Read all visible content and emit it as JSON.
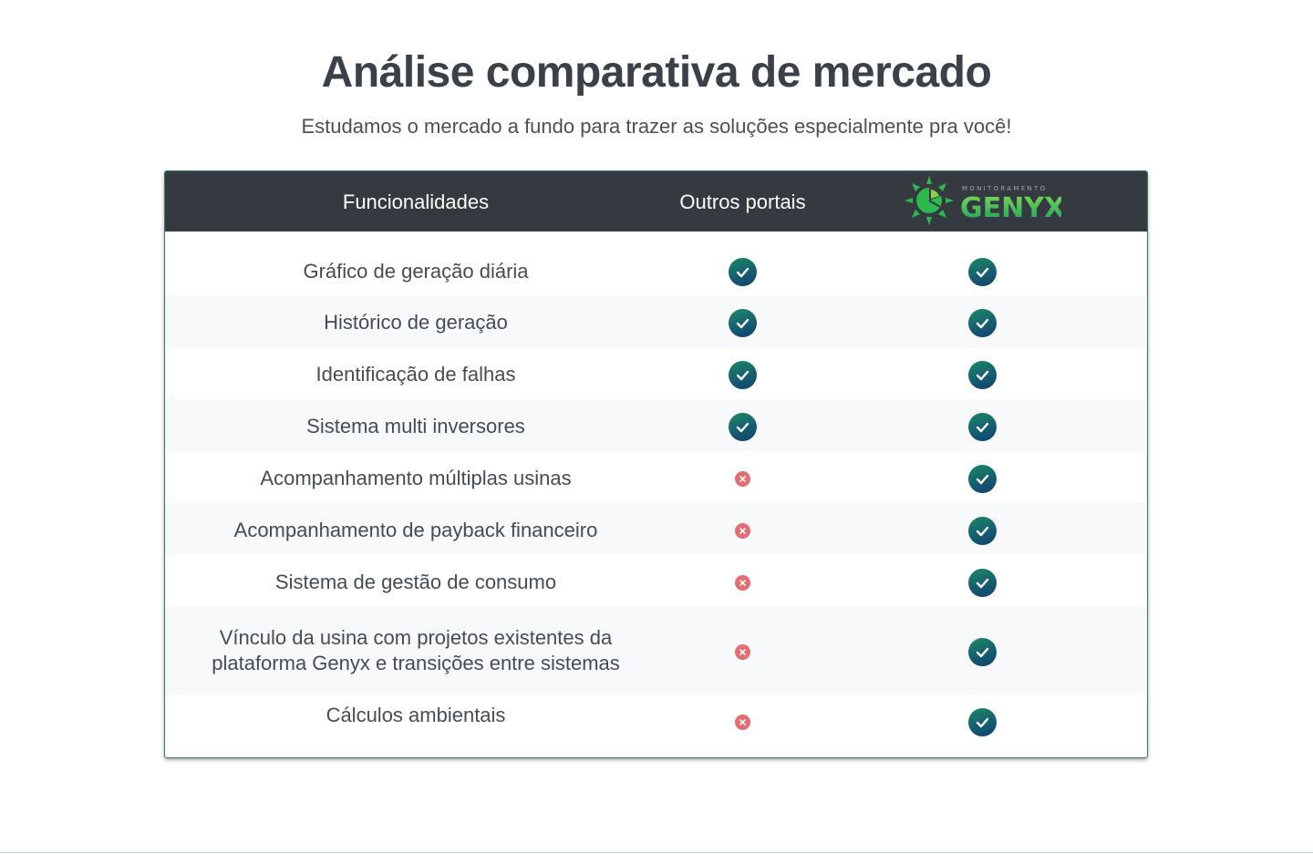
{
  "heading": {
    "title": "Análise comparativa de mercado",
    "subtitle": "Estudamos o mercado a fundo para trazer as soluções especialmente pra você!"
  },
  "table": {
    "columns": {
      "features": "Funcionalidades",
      "others": "Outros portais",
      "genyx_logo": {
        "tagline": "MONITORAMENTO",
        "brand": "GENYX"
      }
    },
    "rows": [
      {
        "feature": "Gráfico de geração diária",
        "others": "check",
        "genyx": "check"
      },
      {
        "feature": "Histórico de geração",
        "others": "check",
        "genyx": "check"
      },
      {
        "feature": "Identificação de falhas",
        "others": "check",
        "genyx": "check"
      },
      {
        "feature": "Sistema multi inversores",
        "others": "check",
        "genyx": "check"
      },
      {
        "feature": "Acompanhamento múltiplas usinas",
        "others": "cross",
        "genyx": "check"
      },
      {
        "feature": "Acompanhamento de payback financeiro",
        "others": "cross",
        "genyx": "check"
      },
      {
        "feature": "Sistema de gestão de consumo",
        "others": "cross",
        "genyx": "check"
      },
      {
        "feature_lines": [
          "Vínculo da usina com projetos existentes da",
          "plataforma Genyx e transições entre sistemas"
        ],
        "others": "cross",
        "genyx": "check"
      },
      {
        "feature": "Cálculos ambientais",
        "others": "cross",
        "genyx": "check"
      }
    ]
  },
  "colors": {
    "header_bg": "#343a40",
    "check_green": "#1d8a63",
    "check_blue": "#12406b",
    "cross_red": "#e56d72",
    "logo_green": "#2fb84f"
  },
  "icons": {
    "check": "check-circle-icon",
    "cross": "x-circle-icon",
    "logo": "sun-pie-icon"
  }
}
